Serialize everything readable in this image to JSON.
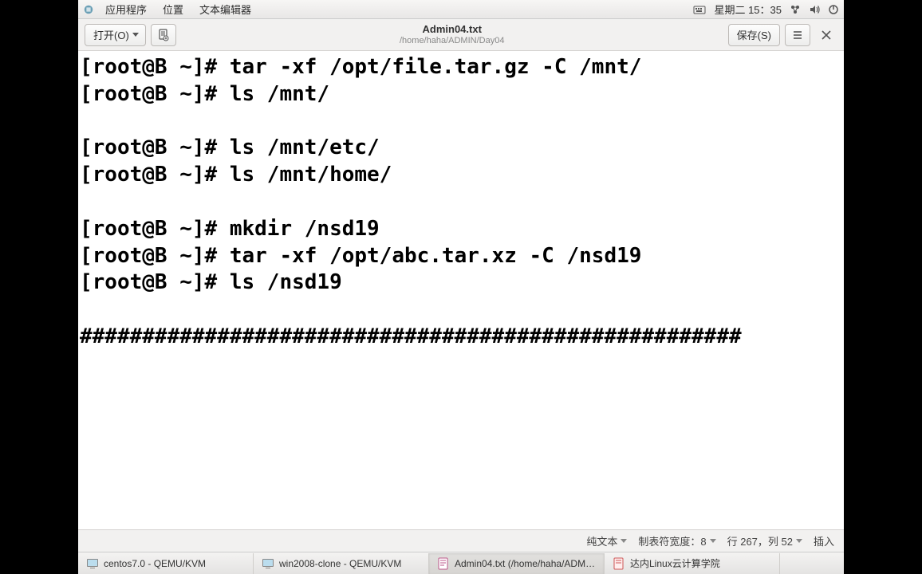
{
  "top_panel": {
    "applications": "应用程序",
    "places": "位置",
    "text_editor": "文本编辑器",
    "datetime": "星期二 15：35"
  },
  "header": {
    "open": "打开(O)",
    "title": "Admin04.txt",
    "subtitle": "/home/haha/ADMIN/Day04",
    "save": "保存(S)"
  },
  "editor": {
    "lines": [
      "[root@B ~]# tar -xf /opt/file.tar.gz -C /mnt/",
      "[root@B ~]# ls /mnt/",
      "",
      "[root@B ~]# ls /mnt/etc/",
      "[root@B ~]# ls /mnt/home/",
      "",
      "[root@B ~]# mkdir /nsd19",
      "[root@B ~]# tar -xf /opt/abc.tar.xz -C /nsd19",
      "[root@B ~]# ls /nsd19",
      "",
      "#####################################################"
    ]
  },
  "status": {
    "filetype": "纯文本",
    "tabwidth": "制表符宽度：8",
    "position": "行 267，列 52",
    "mode": "插入"
  },
  "taskbar": {
    "items": [
      "centos7.0 - QEMU/KVM",
      "win2008-clone - QEMU/KVM",
      "Admin04.txt (/home/haha/ADM…",
      "达内Linux云计算学院"
    ]
  }
}
